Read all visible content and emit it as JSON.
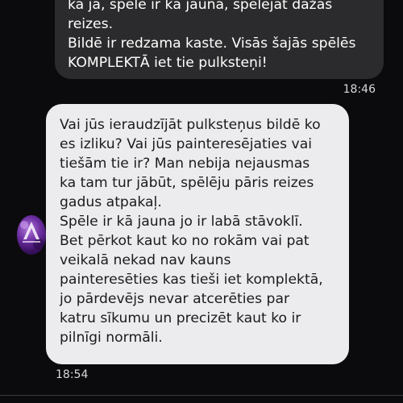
{
  "conversation": {
    "outgoing": {
      "lines": [
        "ka jā, spēle ir kā jauna, spēlējāt dažas",
        "reizes.",
        "Bildē ir redzama kaste. Visās šajās spēlēs",
        "KOMPLEKTĀ iet tie pulksteņi!"
      ],
      "time": "18:46"
    },
    "incoming": {
      "sender_avatar_icon": "purple-triangle-avatar-icon",
      "lines": [
        "Vai jūs ieraudzījāt pulksteņus bildē ko",
        "es izliku? Vai jūs painteresējaties vai",
        "tiešām tie ir? Man nebija nejausmas",
        "ka tam tur jābūt, spēlēju pāris reizes",
        "gadus atpakaļ.",
        "Spēle ir kā jauna jo ir labā stāvoklī.",
        "Bet pērkot kaut ko no rokām vai pat",
        "veikalā nekad nav kauns",
        "painteresēties kas tieši iet komplektā,",
        "jo pārdevējs  nevar atcerēties par",
        "katru sīkumu un precizēt kaut ko ir",
        "pilnīgi normāli."
      ],
      "time": "18:54"
    }
  },
  "colors": {
    "background": "#0b0b0d",
    "outgoing_bubble": "#2b2b2d",
    "incoming_bubble": "#ececee",
    "timestamp": "#d8d8da"
  }
}
